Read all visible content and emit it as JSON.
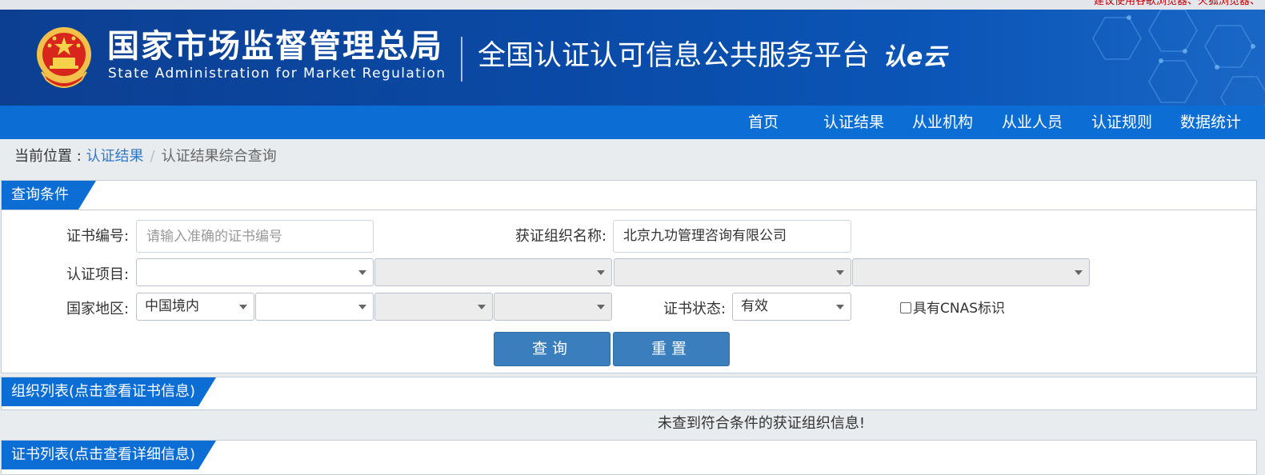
{
  "top_notice": "建议使用谷歌浏览器、火狐浏览器、",
  "header": {
    "agency_cn": "国家市场监督管理总局",
    "agency_en": "State Administration  for  Market Regulation",
    "platform_title": "全国认证认可信息公共服务平台",
    "platform_logo": "认e云"
  },
  "nav": {
    "items": [
      {
        "label": "首页"
      },
      {
        "label": "认证结果"
      },
      {
        "label": "从业机构"
      },
      {
        "label": "从业人员"
      },
      {
        "label": "认证规则"
      },
      {
        "label": "数据统计"
      }
    ]
  },
  "breadcrumb": {
    "prefix": "当前位置 : ",
    "link": "认证结果",
    "separator": "/",
    "current": "认证结果综合查询"
  },
  "query": {
    "section_title": "查询条件",
    "cert_no_label": "证书编号:",
    "cert_no_placeholder": "请输入准确的证书编号",
    "cert_no_value": "",
    "org_name_label": "获证组织名称:",
    "org_name_value": "北京九功管理咨询有限公司",
    "project_label": "认证项目:",
    "project_values": [
      "",
      "",
      "",
      ""
    ],
    "region_label": "国家地区:",
    "region_values": [
      "中国境内",
      "",
      "",
      ""
    ],
    "status_label": "证书状态:",
    "status_value": "有效",
    "cnas_label": "具有CNAS标识",
    "search_button": "查询",
    "reset_button": "重置"
  },
  "org_list": {
    "title": "组织列表(点击查看证书信息)",
    "empty_message": "未查到符合条件的获证组织信息!"
  },
  "cert_list": {
    "title": "证书列表(点击查看详细信息)"
  },
  "colors": {
    "banner": "#0a4aa6",
    "nav": "#0c6ed5",
    "button": "#3a7ebd",
    "link": "#2f78c6",
    "notice": "#c00000"
  }
}
